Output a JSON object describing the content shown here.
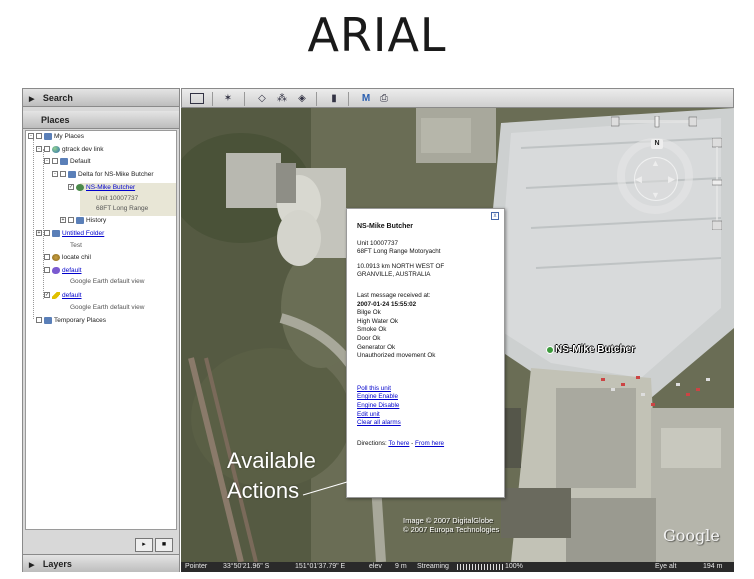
{
  "slide": {
    "title": "ARIAL"
  },
  "sidebar": {
    "search_label": "Search",
    "places_label": "Places",
    "layers_label": "Layers",
    "tree": {
      "my_places": "My Places",
      "gtrack": "gtrack dev link",
      "default_folder": "Default",
      "delta": "Delta for NS-Mike Butcher",
      "placemark": "NS-Mike Butcher",
      "placemark_unit": "Unit 10007737",
      "placemark_desc": "68FT Long Range",
      "history": "History",
      "untitled": "Untitled Folder",
      "test": "Test",
      "locate": "locate chil",
      "default_link_1": "default",
      "default_desc_1": "Google Earth default view",
      "default_link_2": "default",
      "default_desc_2": "Google Earth default view",
      "temporary": "Temporary Places"
    },
    "controls": {
      "play": "▸",
      "stop": "■"
    }
  },
  "balloon": {
    "title": "NS-Mike Butcher",
    "unit": "Unit 10007737",
    "vessel": "68FT Long Range Motoryacht",
    "location_1": "10.0913 km NORTH WEST OF",
    "location_2": "GRANVILLE, AUSTRALIA",
    "last_message": "Last message received at:",
    "timestamp": "2007-01-24 15:55:02",
    "status": [
      "Bilge Ok",
      "High Water Ok",
      "Smoke Ok",
      "Door Ok",
      "Generator Ok",
      "Unauthorized movement Ok"
    ],
    "actions": [
      "Poll this unit",
      "Engine Enable",
      "Engine Disable",
      "Edit unit",
      "Clear all alarms"
    ],
    "directions_label": "Directions:",
    "to_here": "To here",
    "separator": "-",
    "from_here": "From here"
  },
  "map": {
    "placemark_label": "NS-Mike Butcher",
    "annotation_1": "Available",
    "annotation_2": "Actions",
    "copyright_1": "Image © 2007 DigitalGlobe",
    "copyright_2": "© 2007 Europa Technologies",
    "logo": "Google",
    "nav_north": "N"
  },
  "status_bar": {
    "pointer_label": "Pointer",
    "lat": "33°50'21.96\" S",
    "lon": "151°01'37.79\" E",
    "elev_label": "elev",
    "elev_value": "9 m",
    "streaming_label": "Streaming",
    "streaming_percent": "100%",
    "eye_alt_label": "Eye alt",
    "eye_alt_value": "194 m"
  },
  "colors": {
    "link": "#0000cc",
    "status_bar_bg": "#2a2a2a",
    "placemark": "#3c9a3c"
  }
}
